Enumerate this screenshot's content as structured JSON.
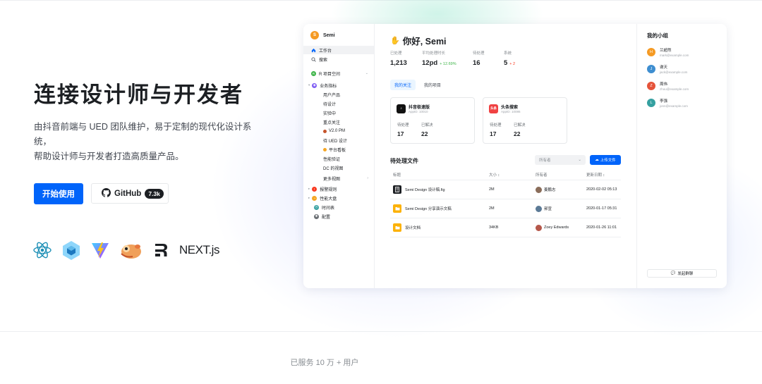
{
  "hero": {
    "title": "连接设计师与开发者",
    "desc_line1": "由抖音前端与 UED 团队维护，易于定制的现代化设计系统，",
    "desc_line2": "帮助设计师与开发者打造高质量产品。",
    "start_button": "开始使用",
    "github_button": "GitHub",
    "github_stars": "7.3k",
    "tech_icons": [
      "react-icon",
      "webpack-icon",
      "vite-icon",
      "rspack-icon",
      "remix-icon",
      "nextjs-icon"
    ],
    "nextjs_label": "NEXT.js"
  },
  "app": {
    "brand": "Semi",
    "brand_initial": "S",
    "nav": {
      "workbench": "工作台",
      "search": "搜索",
      "project_space": "R 项目空间",
      "project_initial": "R",
      "business_metrics": "业务指标",
      "user_product": "用户产品",
      "to_design": "待设计",
      "in_experiment": "实验中",
      "focus": "重点关注",
      "v2_pm": "V2.0 PM",
      "to_ued": "待 UED 设计",
      "platform_board": "平台看板",
      "perf_verify": "性能验证",
      "dc_dashboard": "DC 的视图",
      "more_views": "更多视图",
      "alert_rules": "报警规则",
      "perf_board": "性能大盘",
      "timeline": "时间表",
      "settings": "配置"
    },
    "greeting": "你好, Semi",
    "stats": [
      {
        "label": "已处理",
        "value": "1,213",
        "delta": ""
      },
      {
        "label": "平均处理时长",
        "value": "12pd",
        "delta": "+ 12.69%"
      },
      {
        "label": "待处理",
        "value": "16",
        "delta": ""
      },
      {
        "label": "系统",
        "value": "5",
        "delta": "+ 2"
      }
    ],
    "tabs": [
      "我的关注",
      "我的项目"
    ],
    "projects": [
      {
        "name": "抖音极速版",
        "app_id": "AppID: 10010",
        "todo_label": "待处理",
        "todo": "17",
        "done_label": "已解决",
        "done": "22"
      },
      {
        "name": "头条搜索",
        "logo_text": "头条",
        "app_id": "AppID: 10086",
        "todo_label": "待处理",
        "todo": "17",
        "done_label": "已解决",
        "done": "22"
      }
    ],
    "files_title": "待处理文件",
    "owner_select": "所有者",
    "upload_button": "上传文件",
    "table_headers": [
      "标题",
      "大小 ↕",
      "所有者",
      "更新日期 ↕"
    ],
    "files": [
      {
        "title": "Semi Design 设计稿.fig",
        "size": "2M",
        "owner": "姜鹏志",
        "date": "2020-02-02 05:13"
      },
      {
        "title": "Semi Design 分享演示文稿",
        "size": "2M",
        "owner": "郝宣",
        "date": "2020-01-17 05:31"
      },
      {
        "title": "设计文档",
        "size": "34KB",
        "owner": "Zoey Edwards",
        "date": "2020-01-26 11:01"
      }
    ],
    "group_title": "我的小组",
    "members": [
      {
        "initial": "H",
        "name": "兰超然",
        "email": "mark@example.com",
        "color": "#f59a23"
      },
      {
        "initial": "J",
        "name": "谢天",
        "email": "jack@example.com",
        "color": "#3e8ed0"
      },
      {
        "initial": "Z",
        "name": "周伟",
        "email": "zhou@example.com",
        "color": "#e5533a"
      },
      {
        "initial": "L",
        "name": "李强",
        "email": "jonn@example.com",
        "color": "#35a0a0"
      }
    ],
    "group_button": "发起群聊"
  },
  "footer": {
    "served": "已服务 10 万 + 用户"
  },
  "colors": {
    "primary": "#0064fa",
    "success": "#3bb346",
    "danger": "#f93920"
  }
}
